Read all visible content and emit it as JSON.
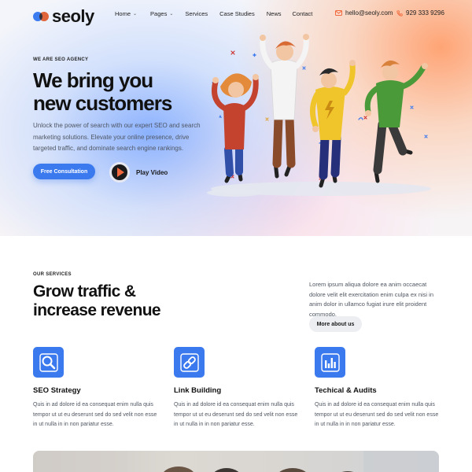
{
  "brand": {
    "name": "seoly",
    "primary": "#3b79ee",
    "accent": "#f0683c"
  },
  "nav": {
    "items": [
      {
        "label": "Home",
        "dropdown": true
      },
      {
        "label": "Pages",
        "dropdown": true
      },
      {
        "label": "Services",
        "dropdown": false
      },
      {
        "label": "Case Studies",
        "dropdown": false
      },
      {
        "label": "News",
        "dropdown": false
      },
      {
        "label": "Contact",
        "dropdown": false
      }
    ]
  },
  "contact": {
    "email": "hello@seoly.com",
    "email_icon": "envelope-icon",
    "phone": "929 333 9296",
    "phone_icon": "phone-icon"
  },
  "hero": {
    "eyebrow": "WE ARE SEO AGENCY",
    "title_line1": "We bring you",
    "title_line2": "new customers",
    "description": "Unlock the power of search with our expert SEO and search marketing solutions. Elevate your online presence, drive targeted traffic, and dominate search engine rankings.",
    "cta_label": "Free Consultation",
    "video_label": "Play Video"
  },
  "services": {
    "eyebrow": "OUR SERVICES",
    "title_line1": "Grow traffic &",
    "title_line2": "increase revenue",
    "description": "Lorem ipsum aliqua dolore ea anim occaecat dolore velit elit exercitation enim culpa ex nisi in anim dolor in ullamco fugiat irure elit proident commodo.",
    "more_label": "More about us",
    "cards": [
      {
        "icon": "magnifier-icon",
        "title": "SEO Strategy",
        "text": "Quis in ad dolore id ea consequat enim nulla quis tempor ut ut eu deserunt sed do sed velit non esse in ut nulla in in non pariatur esse."
      },
      {
        "icon": "link-icon",
        "title": "Link Building",
        "text": "Quis in ad dolore id ea consequat enim nulla quis tempor ut ut eu deserunt sed do sed velit non esse in ut nulla in in non pariatur esse."
      },
      {
        "icon": "bar-chart-icon",
        "title": "Techical & Audits",
        "text": "Quis in ad dolore id ea consequat enim nulla quis tempor ut ut eu deserunt sed do sed velit non esse in ut nulla in in non pariatur esse."
      }
    ]
  }
}
